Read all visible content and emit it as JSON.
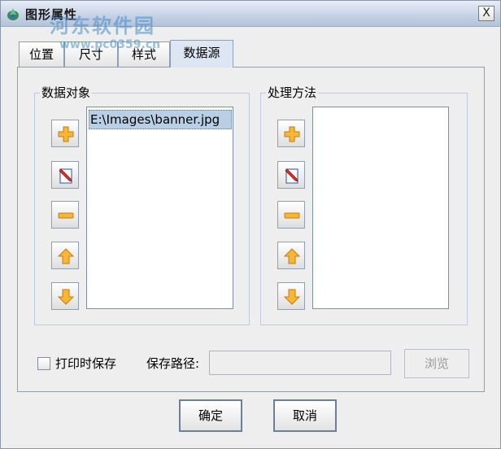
{
  "window": {
    "title": "图形属性",
    "watermark": "河东软件园",
    "watermark_url": "www.pc0359.cn",
    "close_label": "X"
  },
  "tabs": [
    {
      "label": "位置",
      "active": false
    },
    {
      "label": "尺寸",
      "active": false
    },
    {
      "label": "样式",
      "active": false
    },
    {
      "label": "数据源",
      "active": true
    }
  ],
  "data_objects": {
    "title": "数据对象",
    "items": [
      "E:\\Images\\banner.jpg"
    ]
  },
  "processing": {
    "title": "处理方法",
    "items": []
  },
  "save_on_print": {
    "label": "打印时保存",
    "checked": false
  },
  "save_path": {
    "label": "保存路径:",
    "value": ""
  },
  "browse_label": "浏览",
  "ok_label": "确定",
  "cancel_label": "取消",
  "colors": {
    "selection": "#b8cfe5",
    "border": "#8e9fb5",
    "icon_orange": "#f5a623"
  }
}
